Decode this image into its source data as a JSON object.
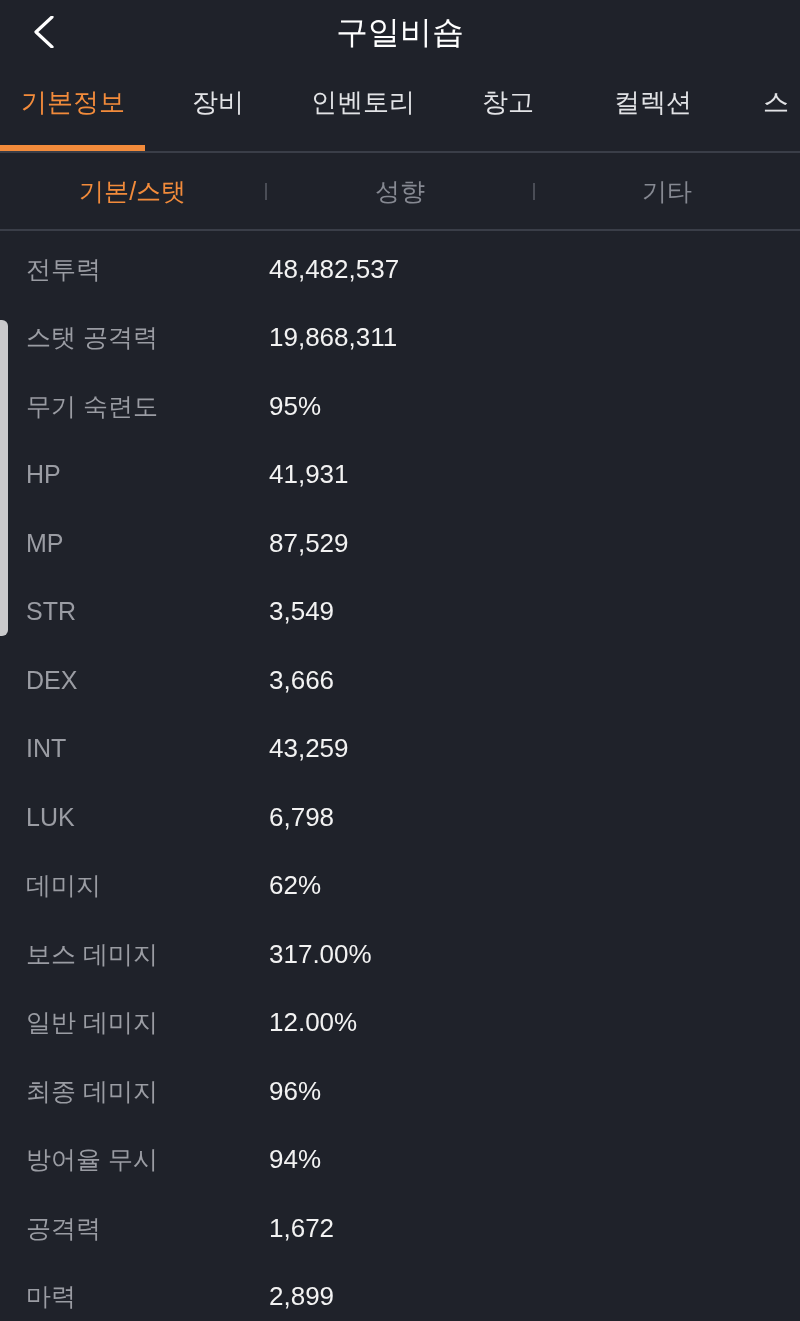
{
  "header": {
    "title": "구일비숍"
  },
  "tabs": [
    {
      "label": "기본정보",
      "selected": true
    },
    {
      "label": "장비",
      "selected": false
    },
    {
      "label": "인벤토리",
      "selected": false
    },
    {
      "label": "창고",
      "selected": false
    },
    {
      "label": "컬렉션",
      "selected": false
    },
    {
      "label": "스",
      "selected": false
    }
  ],
  "subtabs": [
    {
      "label": "기본/스탯",
      "selected": true
    },
    {
      "label": "성향",
      "selected": false
    },
    {
      "label": "기타",
      "selected": false
    }
  ],
  "stats": [
    {
      "label": "전투력",
      "value": "48,482,537"
    },
    {
      "label": "스탯 공격력",
      "value": "19,868,311"
    },
    {
      "label": "무기 숙련도",
      "value": "95%"
    },
    {
      "label": "HP",
      "value": "41,931"
    },
    {
      "label": "MP",
      "value": "87,529"
    },
    {
      "label": "STR",
      "value": "3,549"
    },
    {
      "label": "DEX",
      "value": "3,666"
    },
    {
      "label": "INT",
      "value": "43,259"
    },
    {
      "label": "LUK",
      "value": "6,798"
    },
    {
      "label": "데미지",
      "value": "62%"
    },
    {
      "label": "보스 데미지",
      "value": "317.00%"
    },
    {
      "label": "일반 데미지",
      "value": "12.00%"
    },
    {
      "label": "최종 데미지",
      "value": "96%"
    },
    {
      "label": "방어율 무시",
      "value": "94%"
    },
    {
      "label": "공격력",
      "value": "1,672"
    },
    {
      "label": "마력",
      "value": "2,899"
    }
  ]
}
